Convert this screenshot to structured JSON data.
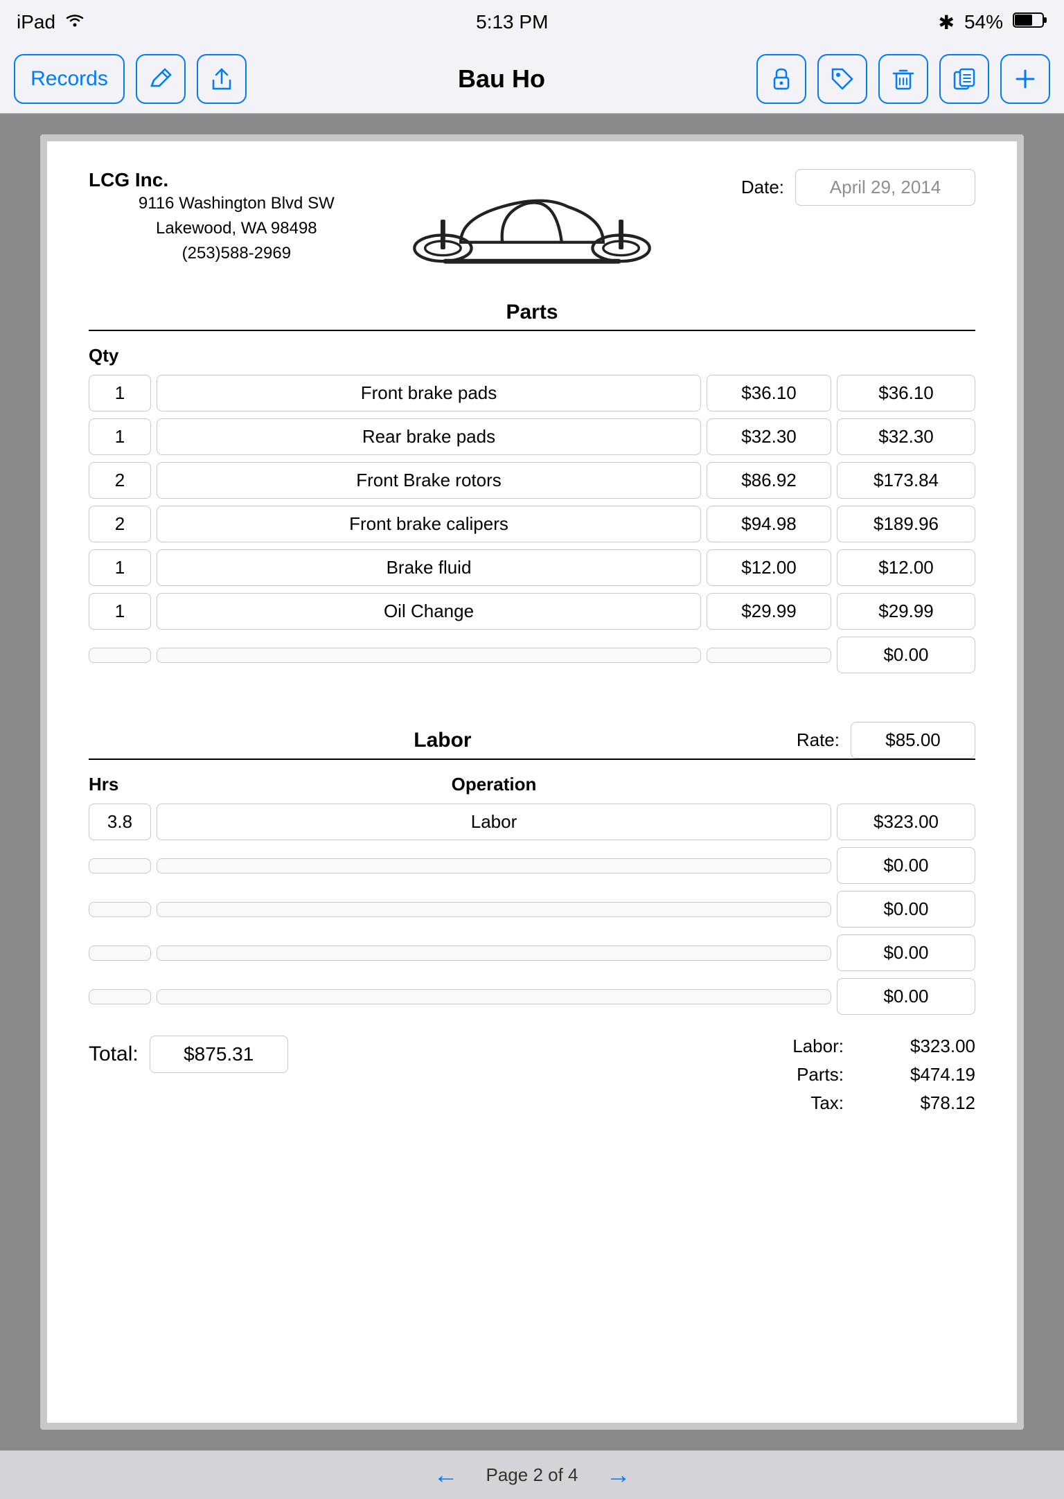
{
  "status_bar": {
    "device": "iPad",
    "wifi_icon": "wifi",
    "time": "5:13 PM",
    "bluetooth_icon": "bluetooth",
    "battery": "54%"
  },
  "toolbar": {
    "records_label": "Records",
    "title": "Bau Ho",
    "edit_icon": "pencil",
    "share_icon": "share",
    "lock_icon": "lock",
    "tag_icon": "tag",
    "delete_icon": "trash",
    "copy_icon": "copy",
    "add_icon": "plus"
  },
  "company": {
    "name": "LCG Inc.",
    "address_line1": "9116 Washington Blvd SW",
    "address_line2": "Lakewood, WA  98498",
    "phone": "(253)588-2969"
  },
  "date_label": "Date:",
  "date_value": "April 29, 2014",
  "parts_section": {
    "heading": "Parts",
    "qty_header": "Qty",
    "rows": [
      {
        "qty": "1",
        "description": "Front brake pads",
        "price": "$36.10",
        "total": "$36.10"
      },
      {
        "qty": "1",
        "description": "Rear brake pads",
        "price": "$32.30",
        "total": "$32.30"
      },
      {
        "qty": "2",
        "description": "Front Brake rotors",
        "price": "$86.92",
        "total": "$173.84"
      },
      {
        "qty": "2",
        "description": "Front brake calipers",
        "price": "$94.98",
        "total": "$189.96"
      },
      {
        "qty": "1",
        "description": "Brake fluid",
        "price": "$12.00",
        "total": "$12.00"
      },
      {
        "qty": "1",
        "description": "Oil Change",
        "price": "$29.99",
        "total": "$29.99"
      },
      {
        "qty": "",
        "description": "",
        "price": "",
        "total": "$0.00"
      }
    ]
  },
  "labor_section": {
    "heading": "Labor",
    "rate_label": "Rate:",
    "rate_value": "$85.00",
    "hrs_header": "Hrs",
    "op_header": "Operation",
    "rows": [
      {
        "hrs": "3.8",
        "operation": "Labor",
        "total": "$323.00"
      },
      {
        "hrs": "",
        "operation": "",
        "total": "$0.00"
      },
      {
        "hrs": "",
        "operation": "",
        "total": "$0.00"
      },
      {
        "hrs": "",
        "operation": "",
        "total": "$0.00"
      },
      {
        "hrs": "",
        "operation": "",
        "total": "$0.00"
      }
    ]
  },
  "totals": {
    "total_label": "Total:",
    "total_value": "$875.31",
    "labor_label": "Labor:",
    "labor_value": "$323.00",
    "parts_label": "Parts:",
    "parts_value": "$474.19",
    "tax_label": "Tax:",
    "tax_value": "$78.12"
  },
  "pagination": {
    "text": "Page 2 of 4",
    "prev_icon": "arrow-left",
    "next_icon": "arrow-right"
  }
}
